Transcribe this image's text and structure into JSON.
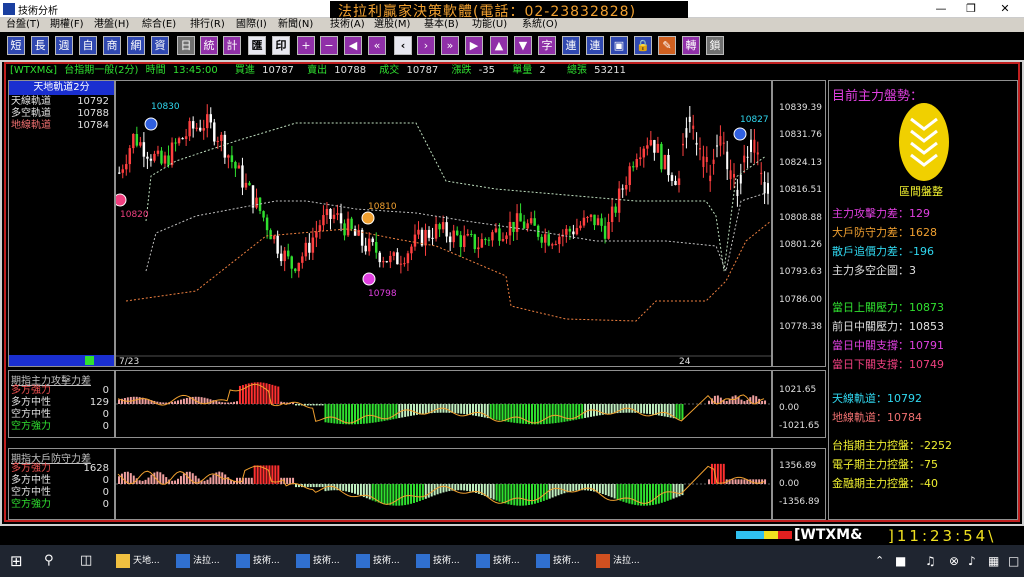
{
  "window": {
    "title": "技術分析",
    "promo": "法拉利贏家決策軟體(電話：02-23832828)"
  },
  "menu": [
    "台盤(T)",
    "期權(F)",
    "港盤(H)",
    "綜合(E)",
    "排行(R)",
    "國際(I)",
    "新聞(N)",
    "技術(A)",
    "選股(M)",
    "基本(B)",
    "功能(U)",
    "系統(O)"
  ],
  "toolbar": [
    "短",
    "長",
    "週",
    "自",
    "商",
    "網",
    "資",
    "日",
    "統",
    "計",
    "匯",
    "印",
    "+",
    "−",
    "◀",
    "«",
    "‹",
    "›",
    "»",
    "▶",
    "▲",
    "▼",
    "字",
    "連",
    "連",
    "▣",
    "🔒",
    "✎",
    "轉",
    "鎖"
  ],
  "quote": {
    "symbol": "[WTXM&]",
    "name": "台指期一般(2分)",
    "time_label": "時間",
    "time": "13:45:00",
    "bid_label": "買進",
    "bid": "10787",
    "ask_label": "賣出",
    "ask": "10788",
    "last_label": "成交",
    "last": "10787",
    "chg_label": "漲跌",
    "chg": "-35",
    "vol_label": "單量",
    "vol": "2",
    "total_label": "總張",
    "total": "53211"
  },
  "legend": {
    "title": "天地軌道2分",
    "rows": [
      {
        "label": "天線軌道",
        "value": "10792",
        "color": "#e0e0e0"
      },
      {
        "label": "多空軌道",
        "value": "10788",
        "color": "#e0e0e0"
      },
      {
        "label": "地線軌道",
        "value": "10784",
        "color": "#f07070"
      }
    ]
  },
  "price_axis": [
    "10839.39",
    "10831.76",
    "10824.13",
    "10816.51",
    "10808.88",
    "10801.26",
    "10793.63",
    "10786.00",
    "10778.38"
  ],
  "annotations": {
    "p1": "10830",
    "p2": "10820",
    "p3": "10810",
    "p4": "10798",
    "p5": "10827"
  },
  "dates": {
    "d1": "7/23",
    "d2": "24"
  },
  "ind1": {
    "title": "期指主力攻擊力差",
    "rows": [
      {
        "label": "多方強力",
        "value": "0",
        "color": "#f05050"
      },
      {
        "label": "多方中性",
        "value": "129",
        "color": "#e0e0e0"
      },
      {
        "label": "空方中性",
        "value": "0",
        "color": "#e0e0e0"
      },
      {
        "label": "空方強力",
        "value": "0",
        "color": "#30e030"
      }
    ],
    "axis": [
      "1021.65",
      "0.00",
      "-1021.65"
    ]
  },
  "ind2": {
    "title": "期指大戶防守力差",
    "rows": [
      {
        "label": "多方強力",
        "value": "1628",
        "color": "#f05050"
      },
      {
        "label": "多方中性",
        "value": "0",
        "color": "#e0e0e0"
      },
      {
        "label": "空方中性",
        "value": "0",
        "color": "#e0e0e0"
      },
      {
        "label": "空方強力",
        "value": "0",
        "color": "#30e030"
      }
    ],
    "axis": [
      "1356.89",
      "0.00",
      "-1356.89"
    ]
  },
  "right": {
    "header": "目前主力盤勢：",
    "status": "區間盤整",
    "rows": [
      {
        "text": "主力攻擊力差：129",
        "color": "#e040e0"
      },
      {
        "text": "大戶防守力差：1628",
        "color": "#f0a030"
      },
      {
        "text": "散戶追價力差：-196",
        "color": "#30d8f0"
      },
      {
        "text": "主力多空企圖：3",
        "color": "#e0e0e0"
      },
      {
        "text": "當日上關壓力：10873",
        "color": "#30e030"
      },
      {
        "text": "前日中關壓力：10853",
        "color": "#e0e0e0"
      },
      {
        "text": "當日中關支撐：10791",
        "color": "#e040e0"
      },
      {
        "text": "當日下關支撐：10749",
        "color": "#f04080"
      },
      {
        "text": "天線軌道：10792",
        "color": "#30d8f0"
      },
      {
        "text": "地線軌道：10784",
        "color": "#f07070"
      },
      {
        "text": "台指期主力控盤：-2252",
        "color": "#f0f030"
      },
      {
        "text": "電子期主力控盤：-75",
        "color": "#f0f030"
      },
      {
        "text": "金融期主力控盤：-40",
        "color": "#f0f030"
      }
    ]
  },
  "bottom": {
    "symbol": "[WTXM&",
    "clock": "]11:23:54\\"
  },
  "taskbar": [
    "天地...",
    "法拉...",
    "技術...",
    "技術...",
    "技術...",
    "技術...",
    "技術...",
    "技術...",
    "法拉..."
  ],
  "colors": {
    "up": "#ff4040",
    "down": "#30e030",
    "accent": "#1a2fd0"
  }
}
